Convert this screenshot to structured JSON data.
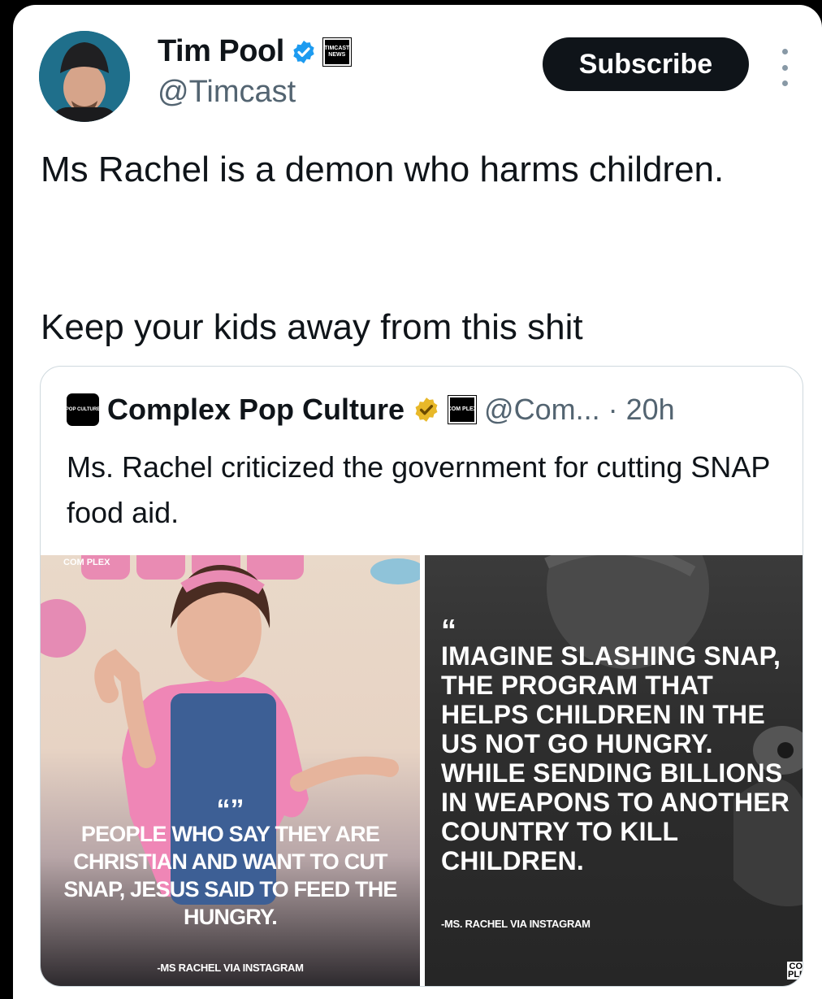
{
  "post": {
    "author_name": "Tim Pool",
    "author_handle": "@Timcast",
    "affiliate_badge": "TIMCAST NEWS",
    "subscribe_label": "Subscribe",
    "text_line1": "Ms Rachel is a demon who harms children.",
    "text_line2": "Keep your kids away from this shit"
  },
  "quoted": {
    "author_name": "Complex Pop Culture",
    "logo_text": "POP CULTURE",
    "affiliate_badge": "COM PLEX",
    "handle": "@Com...",
    "separator": "·",
    "time": "20h",
    "text": "Ms. Rachel criticized the government for cutting SNAP food aid.",
    "left_image": {
      "watermark": "COM PLEX",
      "quote_mark": "“”",
      "quote": "PEOPLE WHO SAY THEY ARE CHRISTIAN AND WANT TO CUT SNAP, JESUS SAID TO FEED THE HUNGRY.",
      "attribution": "-MS RACHEL VIA INSTAGRAM"
    },
    "right_image": {
      "quote_mark": "“",
      "quote": "IMAGINE SLASHING SNAP, THE PROGRAM THAT HELPS CHILDREN IN THE US NOT GO HUNGRY. WHILE SENDING BILLIONS IN WEAPONS TO ANOTHER COUNTRY TO KILL CHILDREN.",
      "attribution": "-MS. RACHEL VIA INSTAGRAM",
      "watermark": "COM PLEX"
    }
  },
  "colors": {
    "verified_blue": "#1d9bf0",
    "verified_gold": "#e8b829",
    "button_dark": "#0f1419",
    "muted_text": "#536471"
  },
  "icons": [
    "verified-badge-icon",
    "gold-verified-badge-icon",
    "more-options-icon"
  ]
}
